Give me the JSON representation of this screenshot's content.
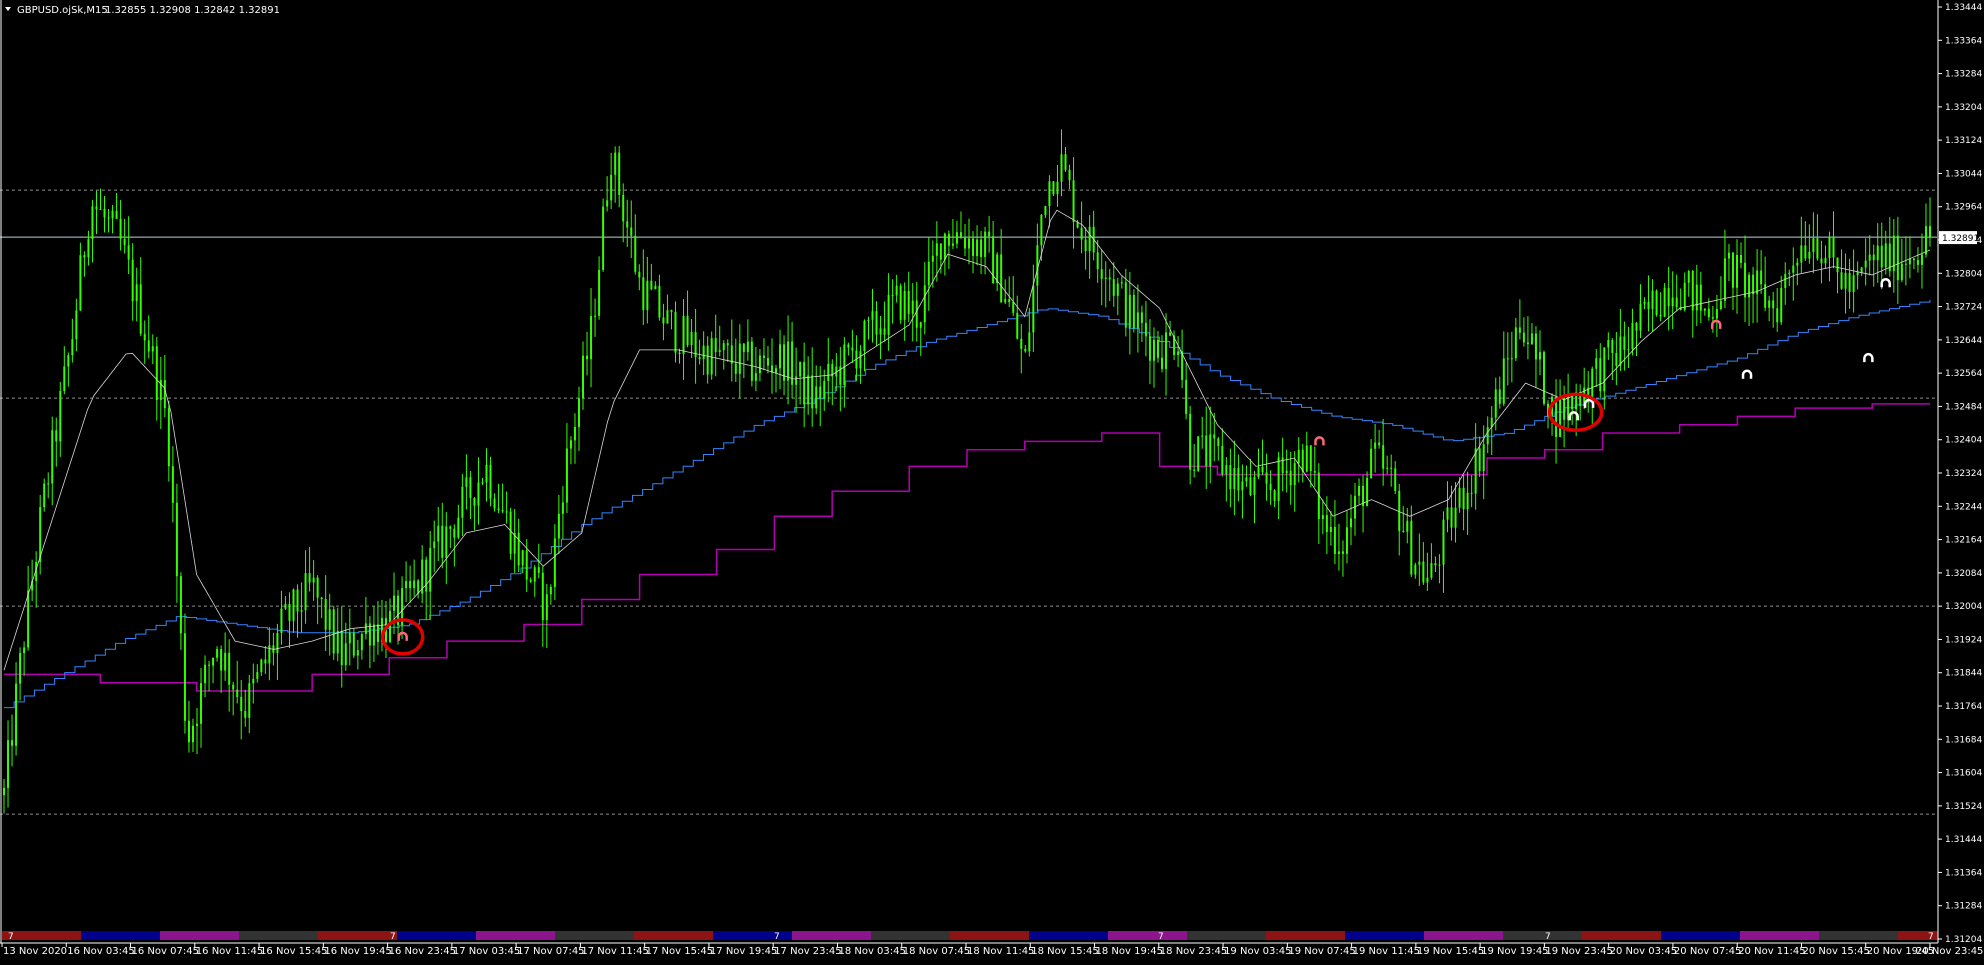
{
  "header": {
    "symbol": "GBPUSD.ojSk,M15",
    "ohlc": "1.32855 1.32908 1.32842 1.32891"
  },
  "colors": {
    "background": "#000000",
    "candles": "#33ff00",
    "fast_ma": "#d9d9d9",
    "slow_ma": "#3385ff",
    "step_line": "#b300b3",
    "current_price_line": "#b3d3e8",
    "level_lines": "#8c8c8c",
    "axis": "#ffffff",
    "markers": "#ffffff",
    "marker_pink": "#ff6680",
    "circle": "#e00000"
  },
  "chart_data": {
    "type": "candlestick",
    "symbol": "GBPUSD.ojSk",
    "timeframe": "M15",
    "ylim": [
      1.31204,
      1.33444
    ],
    "y_ticks": [
      "1.33444",
      "1.33364",
      "1.33284",
      "1.33204",
      "1.33124",
      "1.33044",
      "1.32964",
      "1.32884",
      "1.32804",
      "1.32724",
      "1.32644",
      "1.32564",
      "1.32484",
      "1.32404",
      "1.32324",
      "1.32244",
      "1.32164",
      "1.32084",
      "1.32004",
      "1.31924",
      "1.31844",
      "1.31764",
      "1.31684",
      "1.31604",
      "1.31524",
      "1.31444",
      "1.31364",
      "1.31284",
      "1.31204"
    ],
    "x_ticks": [
      "13 Nov 2020",
      "16 Nov 03:45",
      "16 Nov 07:45",
      "16 Nov 11:45",
      "16 Nov 15:45",
      "16 Nov 19:45",
      "16 Nov 23:45",
      "17 Nov 03:45",
      "17 Nov 07:45",
      "17 Nov 11:45",
      "17 Nov 15:45",
      "17 Nov 19:45",
      "17 Nov 23:45",
      "18 Nov 03:45",
      "18 Nov 07:45",
      "18 Nov 11:45",
      "18 Nov 15:45",
      "18 Nov 19:45",
      "18 Nov 23:45",
      "19 Nov 03:45",
      "19 Nov 07:45",
      "19 Nov 11:45",
      "19 Nov 15:45",
      "19 Nov 19:45",
      "19 Nov 23:45",
      "20 Nov 03:45",
      "20 Nov 07:45",
      "20 Nov 11:45",
      "20 Nov 15:45",
      "20 Nov 19:45",
      "20 Nov 23:45"
    ],
    "current_price": {
      "value": 1.32891,
      "label": "1.32891"
    },
    "horizontal_levels": [
      1.33004,
      1.32504,
      1.32004,
      1.31504
    ],
    "price_path": [
      [
        0,
        1.3155
      ],
      [
        0.01,
        1.3192
      ],
      [
        0.02,
        1.3224
      ],
      [
        0.035,
        1.3264
      ],
      [
        0.045,
        1.3298
      ],
      [
        0.06,
        1.3288
      ],
      [
        0.075,
        1.3264
      ],
      [
        0.085,
        1.3244
      ],
      [
        0.095,
        1.3168
      ],
      [
        0.11,
        1.3192
      ],
      [
        0.125,
        1.3176
      ],
      [
        0.145,
        1.3196
      ],
      [
        0.16,
        1.3205
      ],
      [
        0.175,
        1.3188
      ],
      [
        0.19,
        1.3196
      ],
      [
        0.2,
        1.3196
      ],
      [
        0.21,
        1.3202
      ],
      [
        0.23,
        1.3218
      ],
      [
        0.25,
        1.3234
      ],
      [
        0.27,
        1.321
      ],
      [
        0.282,
        1.32
      ],
      [
        0.29,
        1.323
      ],
      [
        0.305,
        1.3266
      ],
      [
        0.315,
        1.331
      ],
      [
        0.33,
        1.3278
      ],
      [
        0.345,
        1.3268
      ],
      [
        0.36,
        1.3262
      ],
      [
        0.375,
        1.326
      ],
      [
        0.39,
        1.3258
      ],
      [
        0.405,
        1.326
      ],
      [
        0.42,
        1.325
      ],
      [
        0.435,
        1.3258
      ],
      [
        0.45,
        1.3266
      ],
      [
        0.465,
        1.3274
      ],
      [
        0.475,
        1.327
      ],
      [
        0.487,
        1.329
      ],
      [
        0.497,
        1.329
      ],
      [
        0.51,
        1.3286
      ],
      [
        0.52,
        1.3276
      ],
      [
        0.53,
        1.3258
      ],
      [
        0.54,
        1.33
      ],
      [
        0.548,
        1.3308
      ],
      [
        0.56,
        1.329
      ],
      [
        0.57,
        1.3284
      ],
      [
        0.585,
        1.327
      ],
      [
        0.6,
        1.3262
      ],
      [
        0.61,
        1.3266
      ],
      [
        0.615,
        1.3238
      ],
      [
        0.63,
        1.3236
      ],
      [
        0.645,
        1.3228
      ],
      [
        0.66,
        1.323
      ],
      [
        0.675,
        1.3238
      ],
      [
        0.685,
        1.322
      ],
      [
        0.695,
        1.3216
      ],
      [
        0.705,
        1.3228
      ],
      [
        0.712,
        1.3236
      ],
      [
        0.72,
        1.323
      ],
      [
        0.73,
        1.3214
      ],
      [
        0.74,
        1.3206
      ],
      [
        0.75,
        1.322
      ],
      [
        0.76,
        1.323
      ],
      [
        0.77,
        1.3242
      ],
      [
        0.78,
        1.3258
      ],
      [
        0.788,
        1.327
      ],
      [
        0.795,
        1.326
      ],
      [
        0.805,
        1.3246
      ],
      [
        0.815,
        1.325
      ],
      [
        0.825,
        1.3256
      ],
      [
        0.84,
        1.3262
      ],
      [
        0.855,
        1.3272
      ],
      [
        0.865,
        1.3278
      ],
      [
        0.875,
        1.3276
      ],
      [
        0.885,
        1.327
      ],
      [
        0.895,
        1.3282
      ],
      [
        0.91,
        1.3276
      ],
      [
        0.92,
        1.3272
      ],
      [
        0.93,
        1.3286
      ],
      [
        0.94,
        1.329
      ],
      [
        0.95,
        1.3282
      ],
      [
        0.96,
        1.3276
      ],
      [
        0.97,
        1.3284
      ],
      [
        0.985,
        1.3284
      ],
      [
        1,
        1.3289
      ]
    ],
    "fast_ma_path": [
      [
        0,
        1.3185
      ],
      [
        0.02,
        1.3214
      ],
      [
        0.045,
        1.325
      ],
      [
        0.065,
        1.3262
      ],
      [
        0.085,
        1.3252
      ],
      [
        0.1,
        1.3208
      ],
      [
        0.12,
        1.3192
      ],
      [
        0.14,
        1.319
      ],
      [
        0.16,
        1.3192
      ],
      [
        0.18,
        1.3195
      ],
      [
        0.2,
        1.3196
      ],
      [
        0.22,
        1.3206
      ],
      [
        0.24,
        1.3218
      ],
      [
        0.26,
        1.322
      ],
      [
        0.28,
        1.321
      ],
      [
        0.3,
        1.3218
      ],
      [
        0.315,
        1.3248
      ],
      [
        0.33,
        1.3262
      ],
      [
        0.35,
        1.3262
      ],
      [
        0.37,
        1.326
      ],
      [
        0.39,
        1.3258
      ],
      [
        0.41,
        1.3255
      ],
      [
        0.43,
        1.3256
      ],
      [
        0.45,
        1.3262
      ],
      [
        0.47,
        1.3268
      ],
      [
        0.49,
        1.3285
      ],
      [
        0.51,
        1.3282
      ],
      [
        0.53,
        1.327
      ],
      [
        0.545,
        1.3296
      ],
      [
        0.56,
        1.3292
      ],
      [
        0.58,
        1.328
      ],
      [
        0.6,
        1.3272
      ],
      [
        0.615,
        1.3258
      ],
      [
        0.63,
        1.3244
      ],
      [
        0.65,
        1.3234
      ],
      [
        0.67,
        1.3236
      ],
      [
        0.69,
        1.3222
      ],
      [
        0.71,
        1.3226
      ],
      [
        0.73,
        1.3222
      ],
      [
        0.75,
        1.3226
      ],
      [
        0.77,
        1.3242
      ],
      [
        0.79,
        1.3254
      ],
      [
        0.81,
        1.325
      ],
      [
        0.83,
        1.3254
      ],
      [
        0.85,
        1.3264
      ],
      [
        0.87,
        1.3272
      ],
      [
        0.89,
        1.3274
      ],
      [
        0.91,
        1.3276
      ],
      [
        0.93,
        1.328
      ],
      [
        0.95,
        1.3282
      ],
      [
        0.97,
        1.328
      ],
      [
        0.99,
        1.3284
      ],
      [
        1,
        1.3286
      ]
    ],
    "slow_ma_path": [
      [
        0,
        1.3176
      ],
      [
        0.03,
        1.3184
      ],
      [
        0.06,
        1.3192
      ],
      [
        0.09,
        1.3198
      ],
      [
        0.12,
        1.3196
      ],
      [
        0.15,
        1.3194
      ],
      [
        0.18,
        1.3194
      ],
      [
        0.21,
        1.3196
      ],
      [
        0.24,
        1.3202
      ],
      [
        0.27,
        1.321
      ],
      [
        0.3,
        1.322
      ],
      [
        0.33,
        1.3228
      ],
      [
        0.36,
        1.3236
      ],
      [
        0.39,
        1.3244
      ],
      [
        0.42,
        1.325
      ],
      [
        0.45,
        1.3258
      ],
      [
        0.48,
        1.3264
      ],
      [
        0.51,
        1.3268
      ],
      [
        0.54,
        1.3272
      ],
      [
        0.57,
        1.327
      ],
      [
        0.6,
        1.3264
      ],
      [
        0.63,
        1.3256
      ],
      [
        0.66,
        1.325
      ],
      [
        0.69,
        1.3246
      ],
      [
        0.72,
        1.3244
      ],
      [
        0.75,
        1.324
      ],
      [
        0.78,
        1.3242
      ],
      [
        0.81,
        1.3248
      ],
      [
        0.84,
        1.3252
      ],
      [
        0.87,
        1.3256
      ],
      [
        0.9,
        1.326
      ],
      [
        0.93,
        1.3266
      ],
      [
        0.96,
        1.327
      ],
      [
        1,
        1.3274
      ]
    ],
    "step_line_path": [
      [
        0,
        1.3184
      ],
      [
        0.05,
        1.3182
      ],
      [
        0.1,
        1.318
      ],
      [
        0.13,
        1.318
      ],
      [
        0.16,
        1.3184
      ],
      [
        0.2,
        1.3188
      ],
      [
        0.23,
        1.3192
      ],
      [
        0.27,
        1.3196
      ],
      [
        0.3,
        1.3202
      ],
      [
        0.33,
        1.3208
      ],
      [
        0.37,
        1.3214
      ],
      [
        0.4,
        1.3222
      ],
      [
        0.43,
        1.3228
      ],
      [
        0.47,
        1.3234
      ],
      [
        0.5,
        1.3238
      ],
      [
        0.53,
        1.324
      ],
      [
        0.57,
        1.3242
      ],
      [
        0.6,
        1.3234
      ],
      [
        0.63,
        1.3232
      ],
      [
        0.67,
        1.3232
      ],
      [
        0.7,
        1.3232
      ],
      [
        0.73,
        1.3232
      ],
      [
        0.77,
        1.3236
      ],
      [
        0.8,
        1.3238
      ],
      [
        0.83,
        1.3242
      ],
      [
        0.87,
        1.3244
      ],
      [
        0.9,
        1.3246
      ],
      [
        0.93,
        1.3248
      ],
      [
        0.97,
        1.3249
      ],
      [
        1,
        1.3249
      ]
    ],
    "markers": [
      {
        "t": 0.207,
        "price": 1.3193,
        "color": "pink"
      },
      {
        "t": 0.683,
        "price": 1.324,
        "color": "pink"
      },
      {
        "t": 0.815,
        "price": 1.3246,
        "color": "white"
      },
      {
        "t": 0.823,
        "price": 1.3249,
        "color": "white"
      },
      {
        "t": 0.889,
        "price": 1.3268,
        "color": "pink"
      },
      {
        "t": 0.905,
        "price": 1.3256,
        "color": "white"
      },
      {
        "t": 0.968,
        "price": 1.326,
        "color": "white"
      },
      {
        "t": 0.977,
        "price": 1.3278,
        "color": "white"
      }
    ],
    "circled": [
      {
        "t": 0.207,
        "price": 1.3193
      },
      {
        "t": 0.816,
        "price": 1.3247
      }
    ],
    "session_bar": {
      "colors": [
        "#8c1414",
        "#00008c",
        "#8c148c",
        "#333333"
      ],
      "label": "7"
    }
  }
}
